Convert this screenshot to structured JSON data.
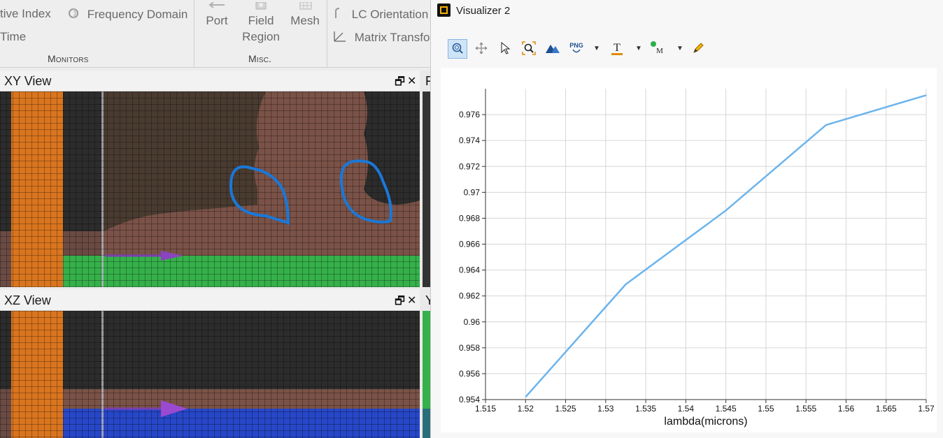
{
  "ribbon": {
    "items": {
      "effective_index": "tive Index",
      "frequency_domain": "Frequency Domain",
      "time": "Time",
      "port": "Port",
      "field_region_1": "Field",
      "field_region_2": "Region",
      "mesh": "Mesh",
      "lc_orientation": "LC Orientation",
      "matrix_transform": "Matrix Transform"
    },
    "groups": {
      "monitors": "Monitors",
      "misc": "Misc."
    }
  },
  "xy_view": {
    "title": "XY View",
    "restore": "🗗",
    "close": "✕",
    "peek": "F"
  },
  "xz_view": {
    "title": "XZ View",
    "restore": "🗗",
    "close": "✕",
    "peek": "Y"
  },
  "visualizer": {
    "title": "Visualizer 2",
    "toolbar": {
      "png_label": "PNG",
      "text_label": "T",
      "marker_label": "M"
    }
  },
  "colors": {
    "line": "#6cb4ec",
    "orange": "#d9751f",
    "green": "#35b04a",
    "blue": "#2747c8",
    "brown": "#7a5247",
    "dark": "#2c2c2c",
    "annotation": "#1a78d8",
    "arrow": "#7a3fb0"
  },
  "chart_data": {
    "type": "line",
    "xlabel": "lambda(microns)",
    "ylabel": "",
    "xlim": [
      1.515,
      1.57
    ],
    "ylim": [
      0.954,
      0.978
    ],
    "xticks": [
      "1.515",
      "1.52",
      "1.525",
      "1.53",
      "1.535",
      "1.54",
      "1.545",
      "1.55",
      "1.555",
      "1.56",
      "1.565",
      "1.57"
    ],
    "yticks": [
      "0.954",
      "0.956",
      "0.958",
      "0.96",
      "0.962",
      "0.964",
      "0.966",
      "0.968",
      "0.97",
      "0.972",
      "0.974",
      "0.976"
    ],
    "grid": true,
    "series": [
      {
        "x": [
          1.52,
          1.5325,
          1.545,
          1.5575,
          1.57
        ],
        "values": [
          0.9542,
          0.9629,
          0.9686,
          0.9752,
          0.9775
        ]
      }
    ]
  }
}
